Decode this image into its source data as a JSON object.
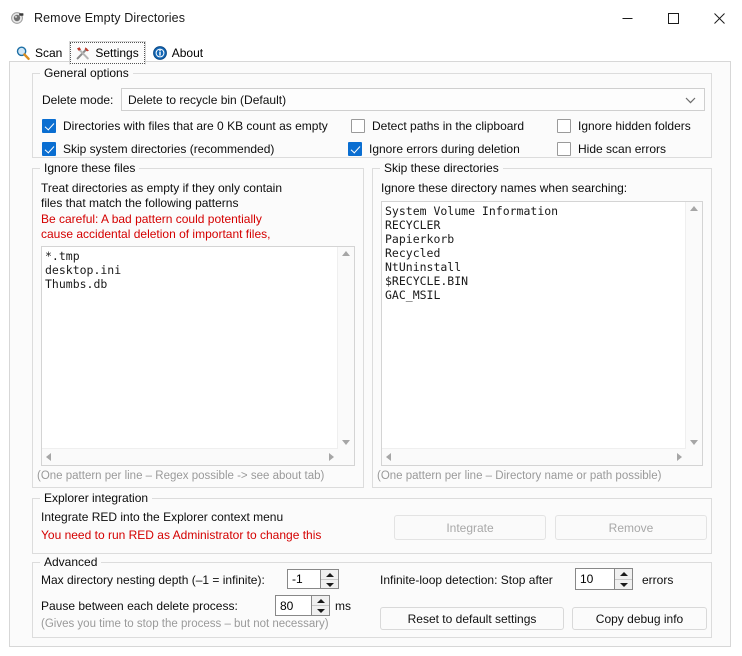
{
  "window": {
    "title": "Remove Empty Directories",
    "app_icon": "magnifier-disc-icon",
    "minimize_label": "—",
    "maximize_label": "□",
    "close_label": "✕"
  },
  "tabs": [
    {
      "label": "Scan",
      "icon": "magnifier-icon",
      "active": false
    },
    {
      "label": "Settings",
      "icon": "tools-icon",
      "active": true
    },
    {
      "label": "About",
      "icon": "info-icon",
      "active": false
    }
  ],
  "general_options": {
    "legend": "General options",
    "delete_mode_label": "Delete mode:",
    "delete_mode_value": "Delete to recycle bin (Default)",
    "delete_mode_options": [
      "Delete to recycle bin (Default)"
    ],
    "checkboxes": [
      {
        "label": "Directories with files that are 0 KB count as empty",
        "checked": true
      },
      {
        "label": "Detect paths in the clipboard",
        "checked": false
      },
      {
        "label": "Ignore hidden folders",
        "checked": false
      },
      {
        "label": "Skip system directories (recommended)",
        "checked": true
      },
      {
        "label": "Ignore errors during deletion",
        "checked": true
      },
      {
        "label": "Hide scan errors",
        "checked": false
      }
    ]
  },
  "ignore_files": {
    "legend": "Ignore these files",
    "desc_line1": "Treat directories as empty if they only contain",
    "desc_line2": "files that match the following patterns",
    "warn_line1": "Be careful: A bad pattern could potentially",
    "warn_line2": "cause accidental deletion of important files,",
    "patterns": "*.tmp\ndesktop.ini\nThumbs.db",
    "footer": "(One pattern per line – Regex possible -> see about tab)"
  },
  "skip_dirs": {
    "legend": "Skip these directories",
    "desc": "Ignore these directory names when searching:",
    "names": "System Volume Information\nRECYCLER\nPapierkorb\nRecycled\nNtUninstall\n$RECYCLE.BIN\nGAC_MSIL",
    "footer": "(One pattern per line – Directory name or path possible)"
  },
  "explorer_integration": {
    "legend": "Explorer integration",
    "desc": "Integrate RED into the Explorer context menu",
    "warn": "You need to run RED as Administrator to change this",
    "integrate_label": "Integrate",
    "remove_label": "Remove"
  },
  "advanced": {
    "legend": "Advanced",
    "max_depth_label": "Max directory nesting depth (–1 = infinite):",
    "max_depth_value": "-1",
    "pause_label": "Pause between each delete process:",
    "pause_value": "80",
    "pause_unit": "ms",
    "pause_note": "(Gives you time to stop the process – but not necessary)",
    "loop_label": "Infinite-loop detection: Stop after",
    "loop_value": "10",
    "loop_unit": "errors",
    "reset_label": "Reset to default settings",
    "copy_debug_label": "Copy debug info"
  },
  "colors": {
    "accent": "#0a6ed1",
    "warning_red": "#d40000",
    "muted_gray": "#9a9a9a",
    "page_bg": "#fbfbfb"
  }
}
